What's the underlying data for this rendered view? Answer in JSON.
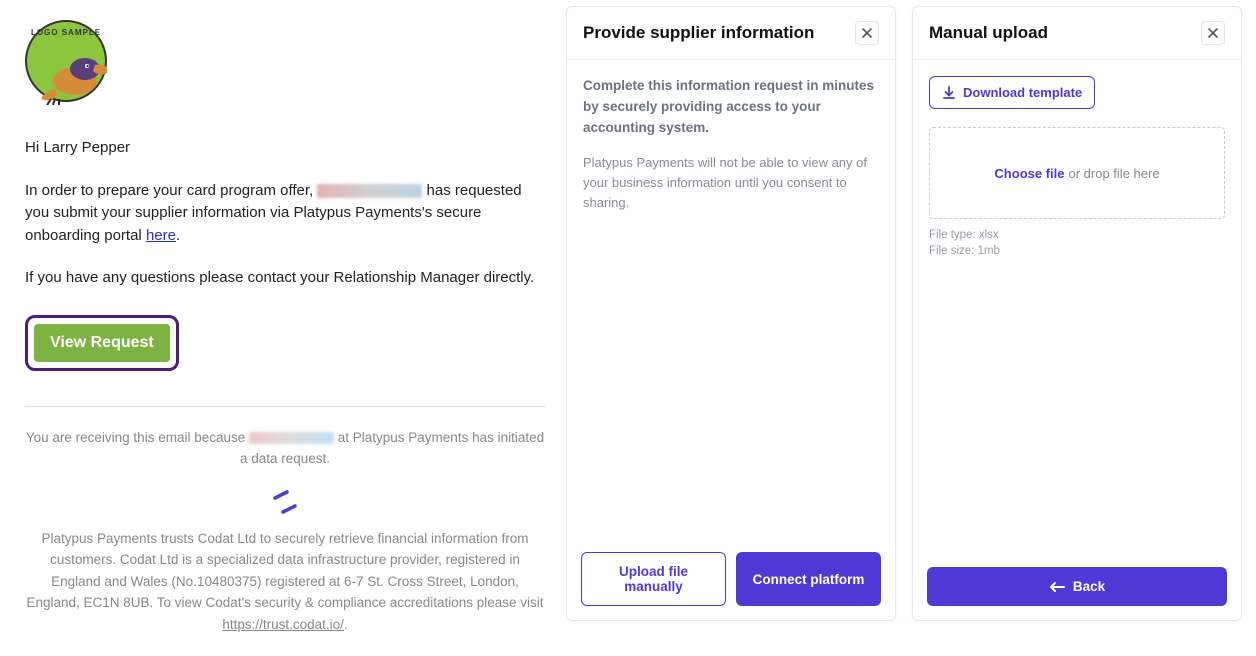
{
  "email": {
    "logo_text": "LOGO SAMPLE",
    "greeting": "Hi Larry Pepper",
    "line1_pre": "In order to prepare your card program offer, ",
    "line1_post": " has requested you submit your supplier information via Platypus Payments's secure onboarding portal ",
    "link_here": "here",
    "line2": "If you have any questions please contact your Relationship Manager directly.",
    "view_request": "View Request",
    "footer1_pre": "You are receiving this email because ",
    "footer1_post": " at Platypus Payments has initiated a data request.",
    "footer2": "Platypus Payments trusts Codat Ltd to securely retrieve financial information from customers. Codat Ltd is a specialized data infrastructure provider, registered in England and Wales (No.10480375) registered at 6-7 St. Cross Street, London, England, EC1N 8UB. To view Codat's security & compliance accreditations please visit ",
    "trust_link": "https://trust.codat.io/"
  },
  "provide": {
    "title": "Provide supplier information",
    "headline": "Complete this information request in minutes by securely providing access to your accounting system.",
    "subtext": "Platypus Payments will not be able to view any of your business information until you consent to sharing.",
    "upload_manually": "Upload file manually",
    "connect_platform": "Connect platform"
  },
  "manual": {
    "title": "Manual upload",
    "download_template": "Download template",
    "choose_file": "Choose file",
    "drop_hint": "or drop file here",
    "file_type": "File type: xlsx",
    "file_size": "File size: 1mb",
    "back": "Back"
  }
}
